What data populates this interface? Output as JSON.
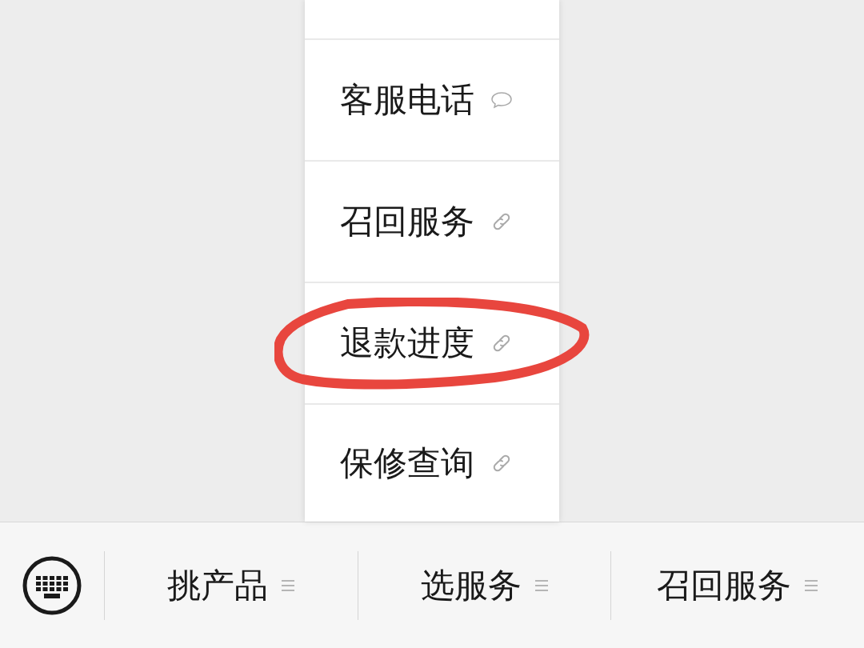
{
  "submenu": {
    "items": [
      {
        "label": "客服电话",
        "kind": "message",
        "circled": false
      },
      {
        "label": "召回服务",
        "kind": "link",
        "circled": false
      },
      {
        "label": "退款进度",
        "kind": "link",
        "circled": true
      },
      {
        "label": "保修查询",
        "kind": "link",
        "circled": false
      }
    ]
  },
  "menu_bar": {
    "items": [
      {
        "label": "挑产品"
      },
      {
        "label": "选服务"
      },
      {
        "label": "召回服务"
      }
    ]
  }
}
